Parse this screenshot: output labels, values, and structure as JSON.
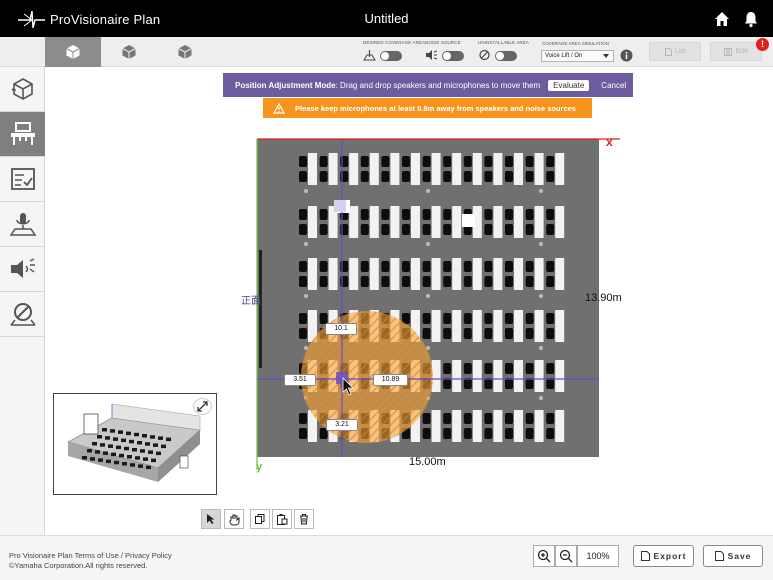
{
  "app": {
    "logo_text": "ProVisionaire Plan",
    "document_title": "Untitled",
    "icons": [
      "home-icon",
      "bell-icon"
    ]
  },
  "toolbar": {
    "view_tabs": [
      "top-view",
      "perspective-view",
      "side-view"
    ],
    "toggles": [
      {
        "label": "DESIRED COVERAGE AREA",
        "icon": "coverage-area-icon",
        "state": "off"
      },
      {
        "label": "NOISE SOURCE",
        "icon": "noise-source-icon",
        "state": "off"
      },
      {
        "label": "UNINSTALLABLE AREA",
        "icon": "uninstallable-area-icon",
        "state": "off"
      }
    ],
    "simulation_label": "COVERAGE AREA SIMULATION",
    "simulation_value": "Voice Lift / On",
    "list_label": "List",
    "edit_label": "Edit",
    "notification_badge": "!"
  },
  "sidebar": {
    "items": [
      {
        "name": "room-layout",
        "icon": "room-cube-icon",
        "active": false
      },
      {
        "name": "furniture",
        "icon": "desk-icon",
        "active": true
      },
      {
        "name": "checklist",
        "icon": "checklist-icon",
        "active": false
      },
      {
        "name": "microphones",
        "icon": "microphone-icon",
        "active": false
      },
      {
        "name": "speakers",
        "icon": "speaker-icon",
        "active": false
      },
      {
        "name": "uninstallable-area",
        "icon": "prohibited-area-icon",
        "active": false
      }
    ]
  },
  "banner": {
    "mode_title": "Position Adjustment Mode",
    "mode_text": ": Drag and drop speakers and microphones to move them",
    "evaluate_label": "Evaluate",
    "cancel_label": "Cancel",
    "warning_text": "Please keep microphones at least 0.8m away from speakers and noise sources",
    "colors": {
      "mode": "#6c5b9d",
      "warning": "#f7941d"
    }
  },
  "plan": {
    "x_axis_label": "x",
    "y_axis_label": "y",
    "width_label": "15.00m",
    "depth_label": "13.90m",
    "front_label": "正面",
    "coordinates": {
      "top": "10.1",
      "left": "3.51",
      "right": "10.89",
      "bottom": "3.21"
    },
    "table_rows": 6,
    "tables_per_row": 13,
    "colors": {
      "room": "#707070",
      "coverage": "#f7a43a",
      "crosshair": "#6c48c9"
    }
  },
  "tools": {
    "items": [
      "select-tool",
      "pan-tool",
      "copy-tool",
      "paste-tool",
      "delete-tool"
    ]
  },
  "footer": {
    "terms_line": "Pro Visionaire Plan Terms of Use / Privacy Policy",
    "copyright": "©Yamaha Corporation.All rights reserved.",
    "zoom_level": "100%",
    "export_label": "Export",
    "save_label": "Save"
  }
}
